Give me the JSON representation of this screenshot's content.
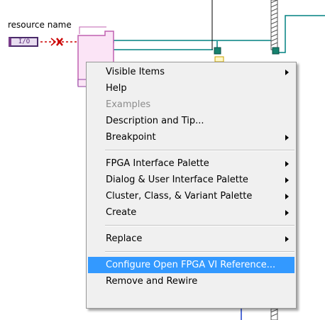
{
  "block_diagram": {
    "resource_label": "resource name",
    "io_terminal_text": "I/O"
  },
  "context_menu": {
    "items": [
      {
        "label": "Visible Items",
        "submenu": true
      },
      {
        "label": "Help"
      },
      {
        "label": "Examples",
        "disabled": true
      },
      {
        "label": "Description and Tip..."
      },
      {
        "label": "Breakpoint",
        "submenu": true
      },
      {
        "label": "FPGA Interface Palette",
        "submenu": true
      },
      {
        "label": "Dialog & User Interface Palette",
        "submenu": true
      },
      {
        "label": "Cluster, Class, & Variant Palette",
        "submenu": true
      },
      {
        "label": "Create",
        "submenu": true
      },
      {
        "label": "Replace",
        "submenu": true
      },
      {
        "label": "Configure Open FPGA VI Reference...",
        "highlighted": true
      },
      {
        "label": "Remove and Rewire"
      }
    ]
  },
  "colors": {
    "highlight": "#3399ff",
    "wire_teal": "#008080",
    "terminal_purple": "#7a3c8c",
    "broken_wire": "#cc0000"
  }
}
